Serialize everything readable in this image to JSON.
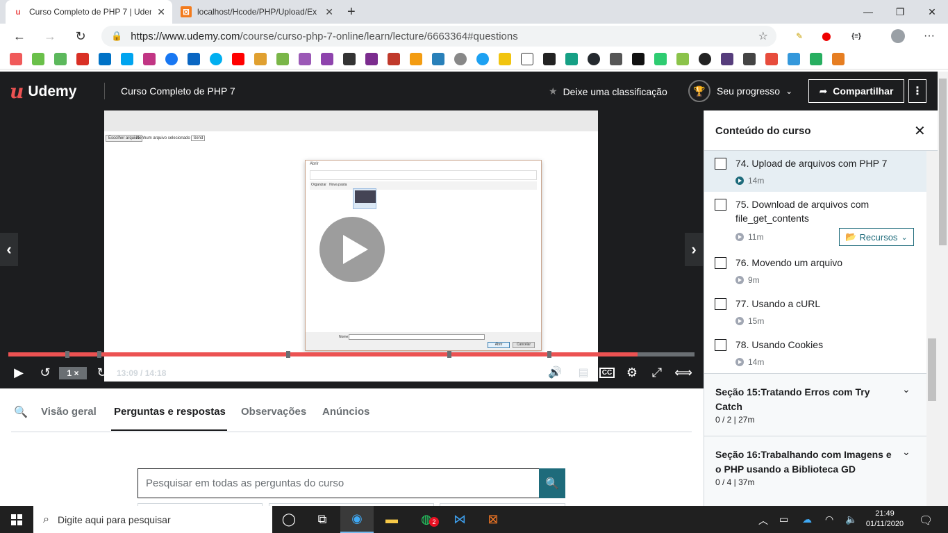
{
  "browser": {
    "tabs": [
      {
        "title": "Curso Completo de PHP 7 | Udemy",
        "icon": "udemy-favicon"
      },
      {
        "title": "localhost/Hcode/PHP/Upload/Ex",
        "icon": "xampp-favicon"
      }
    ],
    "new_tab": "+",
    "url_host": "https://www.udemy.com",
    "url_path": "/course/curso-php-7-online/learn/lecture/6663364#questions"
  },
  "header": {
    "logo": "Udemy",
    "course_title": "Curso Completo de PHP 7",
    "rate_label": "Deixe uma classificação",
    "progress_label": "Seu progresso",
    "share_label": "Compartilhar"
  },
  "player": {
    "speed": "1 ×",
    "time": "13:09 / 14:18",
    "progress_fraction": 0.917,
    "inner_file_button": "Escolher arquivo",
    "inner_file_status": "Nenhum arquivo selecionado",
    "inner_send": "Send",
    "dialog_title": "Abrir",
    "dialog_org": "Organizar",
    "dialog_new": "Nova pasta",
    "dialog_name_label": "Nome:",
    "dialog_open": "Abrir",
    "dialog_cancel": "Cancelar"
  },
  "lower_tabs": {
    "items": [
      "Visão geral",
      "Perguntas e respostas",
      "Observações",
      "Anúncios"
    ],
    "active": "Perguntas e respostas"
  },
  "qa": {
    "search_placeholder": "Pesquisar em todas as perguntas do curso"
  },
  "sidebar": {
    "title": "Conteúdo do curso",
    "lectures": [
      {
        "title": "74. Upload de arquivos com PHP 7",
        "duration": "14m",
        "current": true
      },
      {
        "title": "75. Download de arquivos com file_get_contents",
        "duration": "11m",
        "resources": "Recursos"
      },
      {
        "title": "76. Movendo um arquivo",
        "duration": "9m"
      },
      {
        "title": "77. Usando a cURL",
        "duration": "15m"
      },
      {
        "title": "78. Usando Cookies",
        "duration": "14m"
      }
    ],
    "sections": [
      {
        "title": "Seção 15:Tratando Erros com Try Catch",
        "stats": "0 / 2 | 27m"
      },
      {
        "title": "Seção 16:Trabalhando com Imagens e o PHP usando a Biblioteca GD",
        "stats": "0 / 4 | 37m"
      }
    ]
  },
  "taskbar": {
    "search_placeholder": "Digite aqui para pesquisar",
    "time": "21:49",
    "date": "01/11/2020",
    "whatsapp_badge": "2"
  }
}
